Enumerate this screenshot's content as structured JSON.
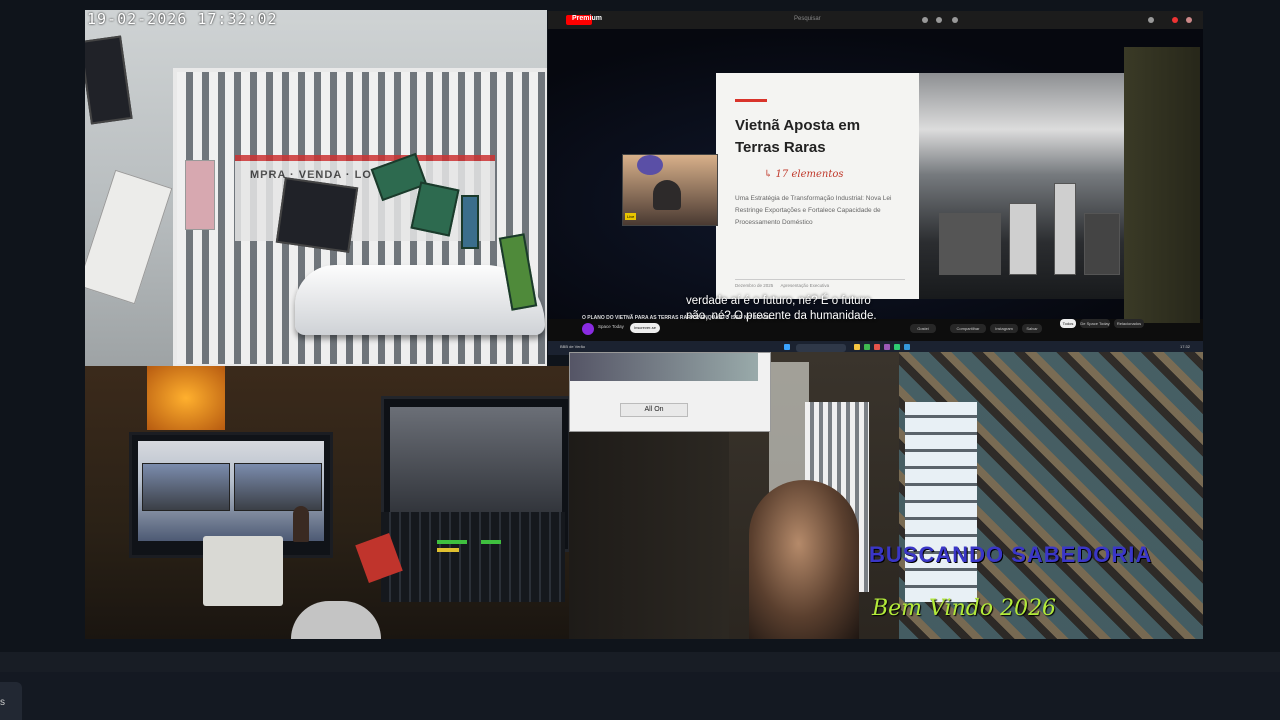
{
  "cctv": {
    "timestamp": "19-02-2026  17:32:02",
    "sign_text": "MPRA · VENDA · LOTEAM"
  },
  "browser": {
    "logo": "Premium",
    "search_placeholder": "Pesquisar",
    "slide": {
      "title_line1": "Vietnã Aposta em",
      "title_line2": "Terras Raras",
      "handwriting": "↳ 17 elementos",
      "subtitle": "Uma Estratégia de Transformação Industrial: Nova Lei Restringe Exportações e Fortalece Capacidade de Processamento Doméstico",
      "footer_left": "Dezembro de 2025",
      "footer_right": "Apresentação Executiva"
    },
    "pip_label": "Live",
    "caption_line1": "verdade aí é o futuro, né? É o futuro",
    "caption_line2": "não, né? O presente da humanidade.",
    "video_title": "O PLANO DO VIETNÃ PARA AS TERRAS RARAS! ENQUANTO ISSO NO BRASIL...",
    "channel_name": "Space Today",
    "subscribe_label": "Inscrever-se",
    "actions": [
      "Gostei",
      "Compartilhar",
      "Instagram",
      "Salvar"
    ],
    "chips": [
      "Todos",
      "De Space Today",
      "Relacionados"
    ],
    "taskbar_left": "BBB de Verão",
    "taskbar_right": "17:32"
  },
  "webcam": {
    "dialog_button": "All On",
    "title": "BUSCANDO SABEDORIA",
    "subtitle": "Bem Vindo 2026"
  },
  "bottom": {
    "tab_label": "s"
  }
}
